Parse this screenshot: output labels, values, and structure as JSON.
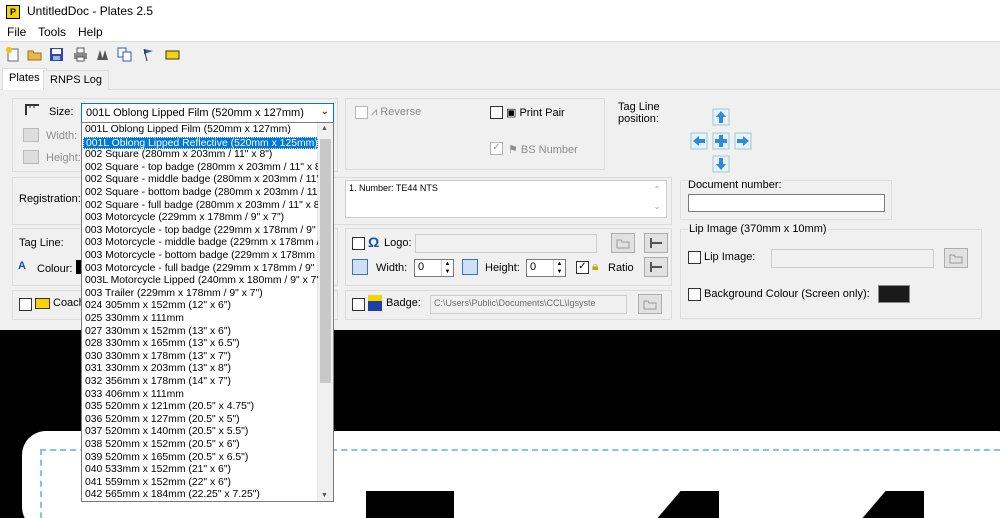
{
  "window": {
    "title": "UntitledDoc - Plates 2.5",
    "app_icon_letter": "P"
  },
  "menu": [
    "File",
    "Tools",
    "Help"
  ],
  "toolbar_icons": [
    "new-document-icon",
    "open-folder-icon",
    "save-icon",
    "print-icon",
    "warning-icon",
    "copy-icon",
    "flag-icon",
    "label-icon"
  ],
  "tabs": [
    "Plates",
    "RNPS Log"
  ],
  "size": {
    "label": "Size:",
    "selected": "001L Oblong Lipped Film (520mm x 127mm)",
    "width_label": "Width:",
    "height_label": "Height:"
  },
  "options": {
    "reverse_label": "Reverse",
    "print_pair_label": "Print Pair",
    "bs_number_label": "BS Number",
    "tag_line_position_label": "Tag Line\nposition:"
  },
  "registration": {
    "label": "Registration:",
    "number_text": "1. Number: TE44 NTS"
  },
  "document": {
    "label": "Document number:",
    "value": ""
  },
  "tagline": {
    "label": "Tag Line:",
    "colour_label": "Colour:"
  },
  "coach_label": "Coach",
  "logo": {
    "label": "Logo:",
    "width_label": "Width:",
    "width_value": "0",
    "height_label": "Height:",
    "height_value": "0",
    "ratio_label": "Ratio"
  },
  "badge": {
    "label": "Badge:",
    "path": "C:\\Users\\Public\\Documents\\CCL\\Igsyste"
  },
  "lip": {
    "group_label": "Lip Image (370mm x 10mm)",
    "lip_image_label": "Lip Image:",
    "bg_colour_label": "Background Colour (Screen only):"
  },
  "dropdown_items": [
    "001L Oblong Lipped Film (520mm x 127mm)",
    "001L Oblong Lipped Reflective (520mm x 125mm)",
    "002 Square (280mm x 203mm / 11\" x 8\")",
    "002 Square - top badge (280mm x 203mm / 11\" x 8",
    "002 Square - middle badge (280mm x 203mm / 11\"",
    "002 Square - bottom badge (280mm x 203mm / 11'",
    "002 Square - full badge (280mm x 203mm / 11\" x 8",
    "003 Motorcycle (229mm x 178mm / 9\" x 7\")",
    "003 Motorcycle - top badge (229mm x 178mm / 9\"",
    "003 Motorcycle - middle badge (229mm x 178mm /",
    "003 Motorcycle - bottom badge (229mm x 178mm /",
    "003 Motorcycle - full badge (229mm x 178mm / 9\" x",
    "003L Motorcycle Lipped (240mm x 180mm / 9\" x 7'",
    "003 Trailer (229mm x 178mm / 9\" x 7\")",
    "024 305mm x 152mm (12\" x 6\")",
    "025 330mm x 111mm",
    "027 330mm x 152mm (13\" x 6\")",
    "028 330mm x 165mm (13\" x 6.5\")",
    "030 330mm x 178mm (13\" x 7\")",
    "031 330mm x 203mm (13\" x 8\")",
    "032 356mm x 178mm (14\" x 7\")",
    "033 406mm x 111mm",
    "035 520mm x 121mm (20.5\" x 4.75\")",
    "036 520mm x 127mm (20.5\" x 5\")",
    "037 520mm x 140mm (20.5\" x 5.5\")",
    "038 520mm x 152mm (20.5\" x 6\")",
    "039 520mm x 165mm (20.5\" x 6.5\")",
    "040 533mm x 152mm (21\" x 6\")",
    "041 559mm x 152mm (22\" x 6\")",
    "042 565mm x 184mm (22.25\" x 7.25\")"
  ],
  "dropdown_selected_index": 1,
  "colors": {
    "accent": "#0078d7",
    "arrow_blue": "#2f8ad8",
    "canvas": "#000000",
    "dashed_border": "#7fc8dc"
  }
}
